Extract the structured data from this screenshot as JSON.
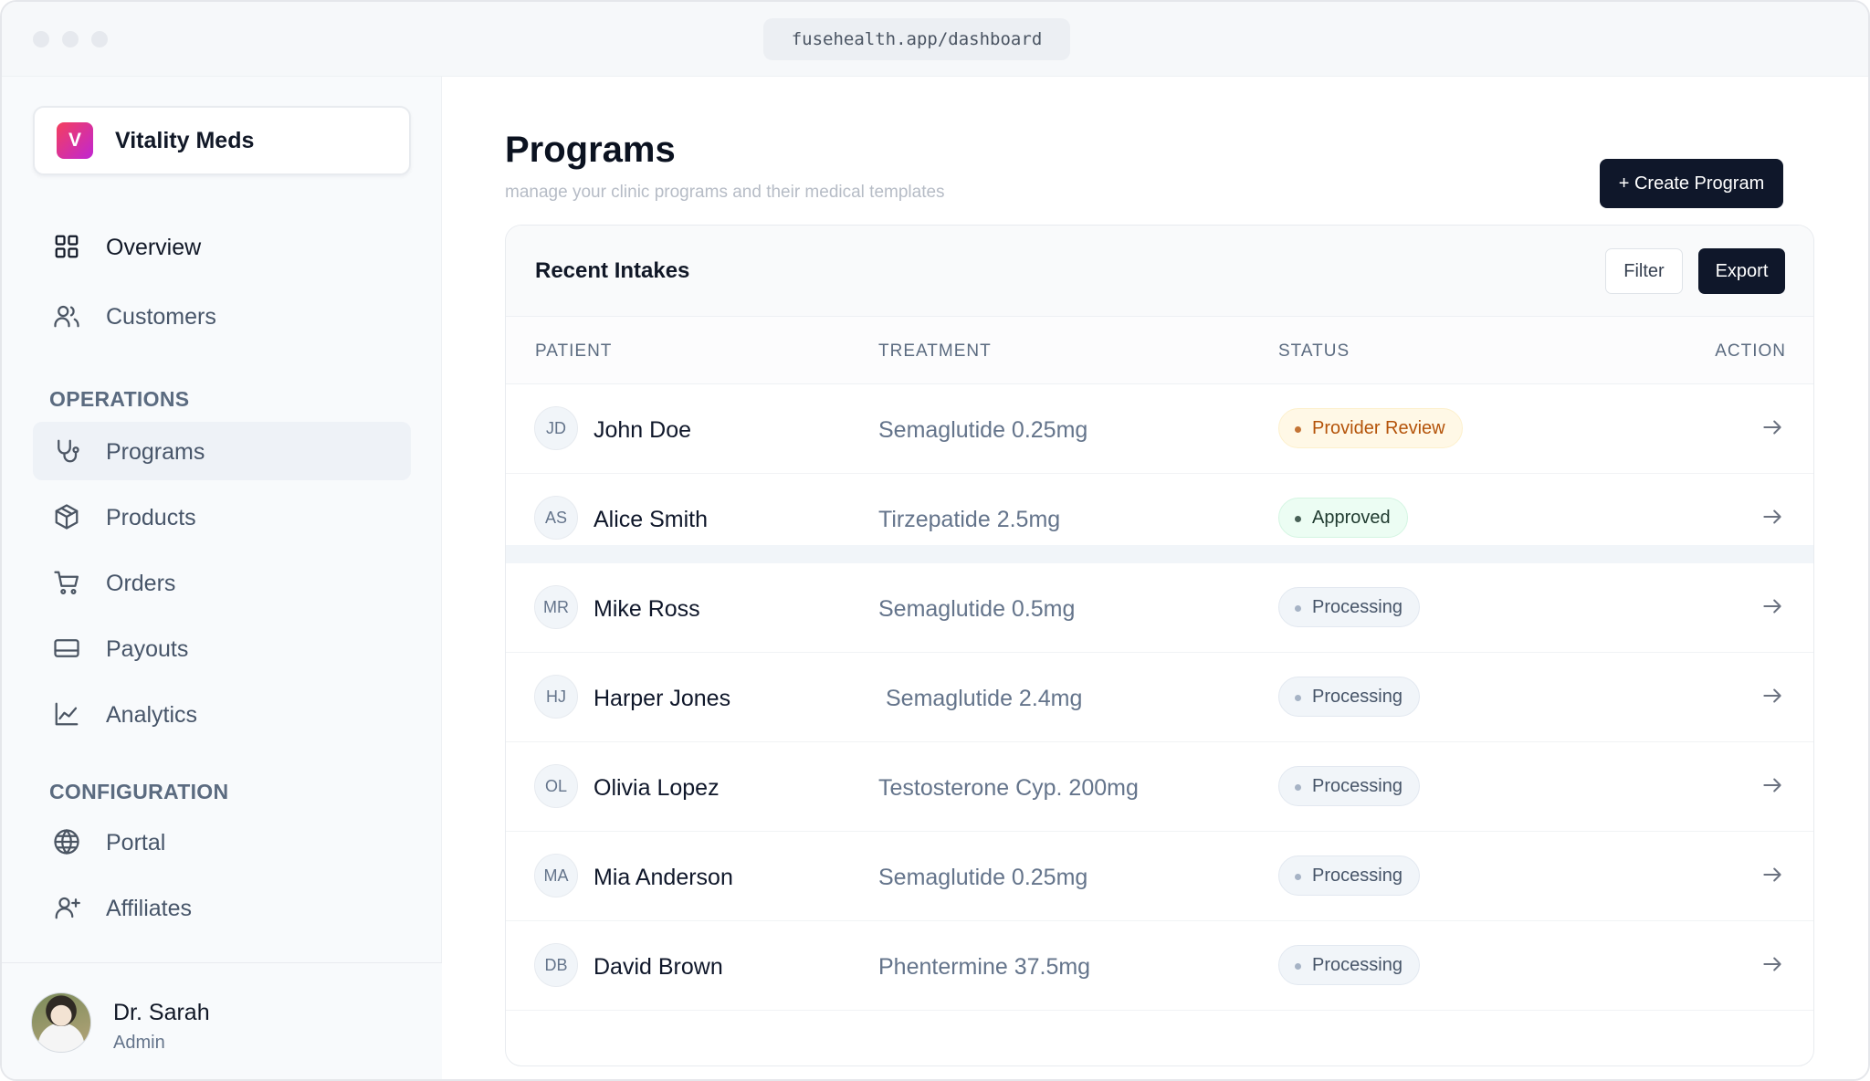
{
  "browser": {
    "url": "fusehealth.app/dashboard"
  },
  "sidebar": {
    "brand": {
      "initial": "V",
      "name": "Vitality Meds"
    },
    "top_items": [
      {
        "label": "Overview",
        "icon": "grid-icon"
      },
      {
        "label": "Customers",
        "icon": "users-icon"
      }
    ],
    "operations": {
      "title": "OPERATIONS",
      "items": [
        {
          "label": "Programs",
          "icon": "stethoscope-icon",
          "active": true
        },
        {
          "label": "Products",
          "icon": "box-icon"
        },
        {
          "label": "Orders",
          "icon": "cart-icon"
        },
        {
          "label": "Payouts",
          "icon": "card-icon"
        },
        {
          "label": "Analytics",
          "icon": "chart-line-icon"
        }
      ]
    },
    "configuration": {
      "title": "CONFIGURATION",
      "items": [
        {
          "label": "Portal",
          "icon": "globe-icon"
        },
        {
          "label": "Affiliates",
          "icon": "user-plus-icon"
        }
      ]
    },
    "user": {
      "name": "Dr. Sarah",
      "role": "Admin"
    }
  },
  "main": {
    "title": "Programs",
    "subtitle": "manage your clinic programs and their medical templates",
    "create_label": "+ Create Program",
    "card": {
      "title": "Recent Intakes",
      "filter_label": "Filter",
      "export_label": "Export",
      "columns": [
        "PATIENT",
        "TREATMENT",
        "STATUS",
        "ACTION"
      ],
      "rows": [
        {
          "initials": "JD",
          "name": "John Doe",
          "treatment": "Semaglutide 0.25mg",
          "status": "Provider Review"
        },
        {
          "initials": "AS",
          "name": "Alice Smith",
          "treatment": "Tirzepatide 2.5mg",
          "status": "Approved"
        },
        {
          "initials": "MR",
          "name": "Mike Ross",
          "treatment": "Semaglutide 0.5mg",
          "status": "Processing"
        },
        {
          "initials": "HJ",
          "name": "Harper Jones",
          "treatment": "Semaglutide 2.4mg",
          "status": "Processing"
        },
        {
          "initials": "OL",
          "name": "Olivia Lopez",
          "treatment": "Testosterone Cyp. 200mg",
          "status": "Processing"
        },
        {
          "initials": "MA",
          "name": "Mia Anderson",
          "treatment": "Semaglutide 0.25mg",
          "status": "Processing"
        },
        {
          "initials": "DB",
          "name": "David Brown",
          "treatment": "Phentermine 37.5mg",
          "status": "Processing"
        }
      ]
    }
  },
  "colors": {
    "primary_button": "#0f172a",
    "review_badge": "#b45309",
    "approved_badge": "#1f3a2f",
    "processing_badge": "#475569"
  }
}
